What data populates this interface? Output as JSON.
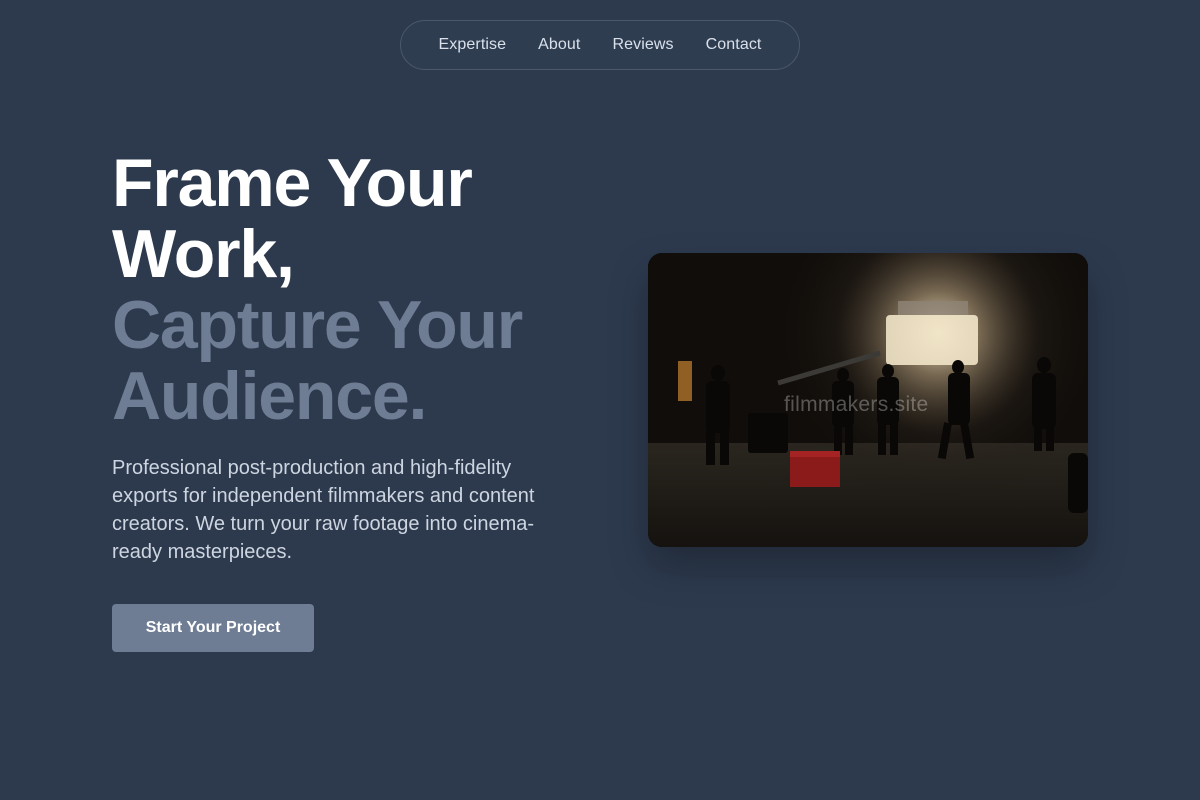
{
  "nav": {
    "items": [
      {
        "label": "Expertise"
      },
      {
        "label": "About"
      },
      {
        "label": "Reviews"
      },
      {
        "label": "Contact"
      }
    ]
  },
  "hero": {
    "headline_lines": [
      "Frame Your",
      "Work,",
      "Capture Your",
      "Audience."
    ],
    "description": "Professional post-production and high-fidelity exports for independent filmmakers and content creators. We turn your raw footage into cinema-ready masterpieces.",
    "cta_label": "Start Your Project"
  },
  "photo": {
    "watermark": "filmmakers.site"
  },
  "colors": {
    "background": "#2d3a4e",
    "headline_light": "#ffffff",
    "headline_muted": "#6e7d93",
    "button_bg": "#6e7d93",
    "nav_text": "#d9e0ea",
    "body_text": "#cdd5e0"
  }
}
